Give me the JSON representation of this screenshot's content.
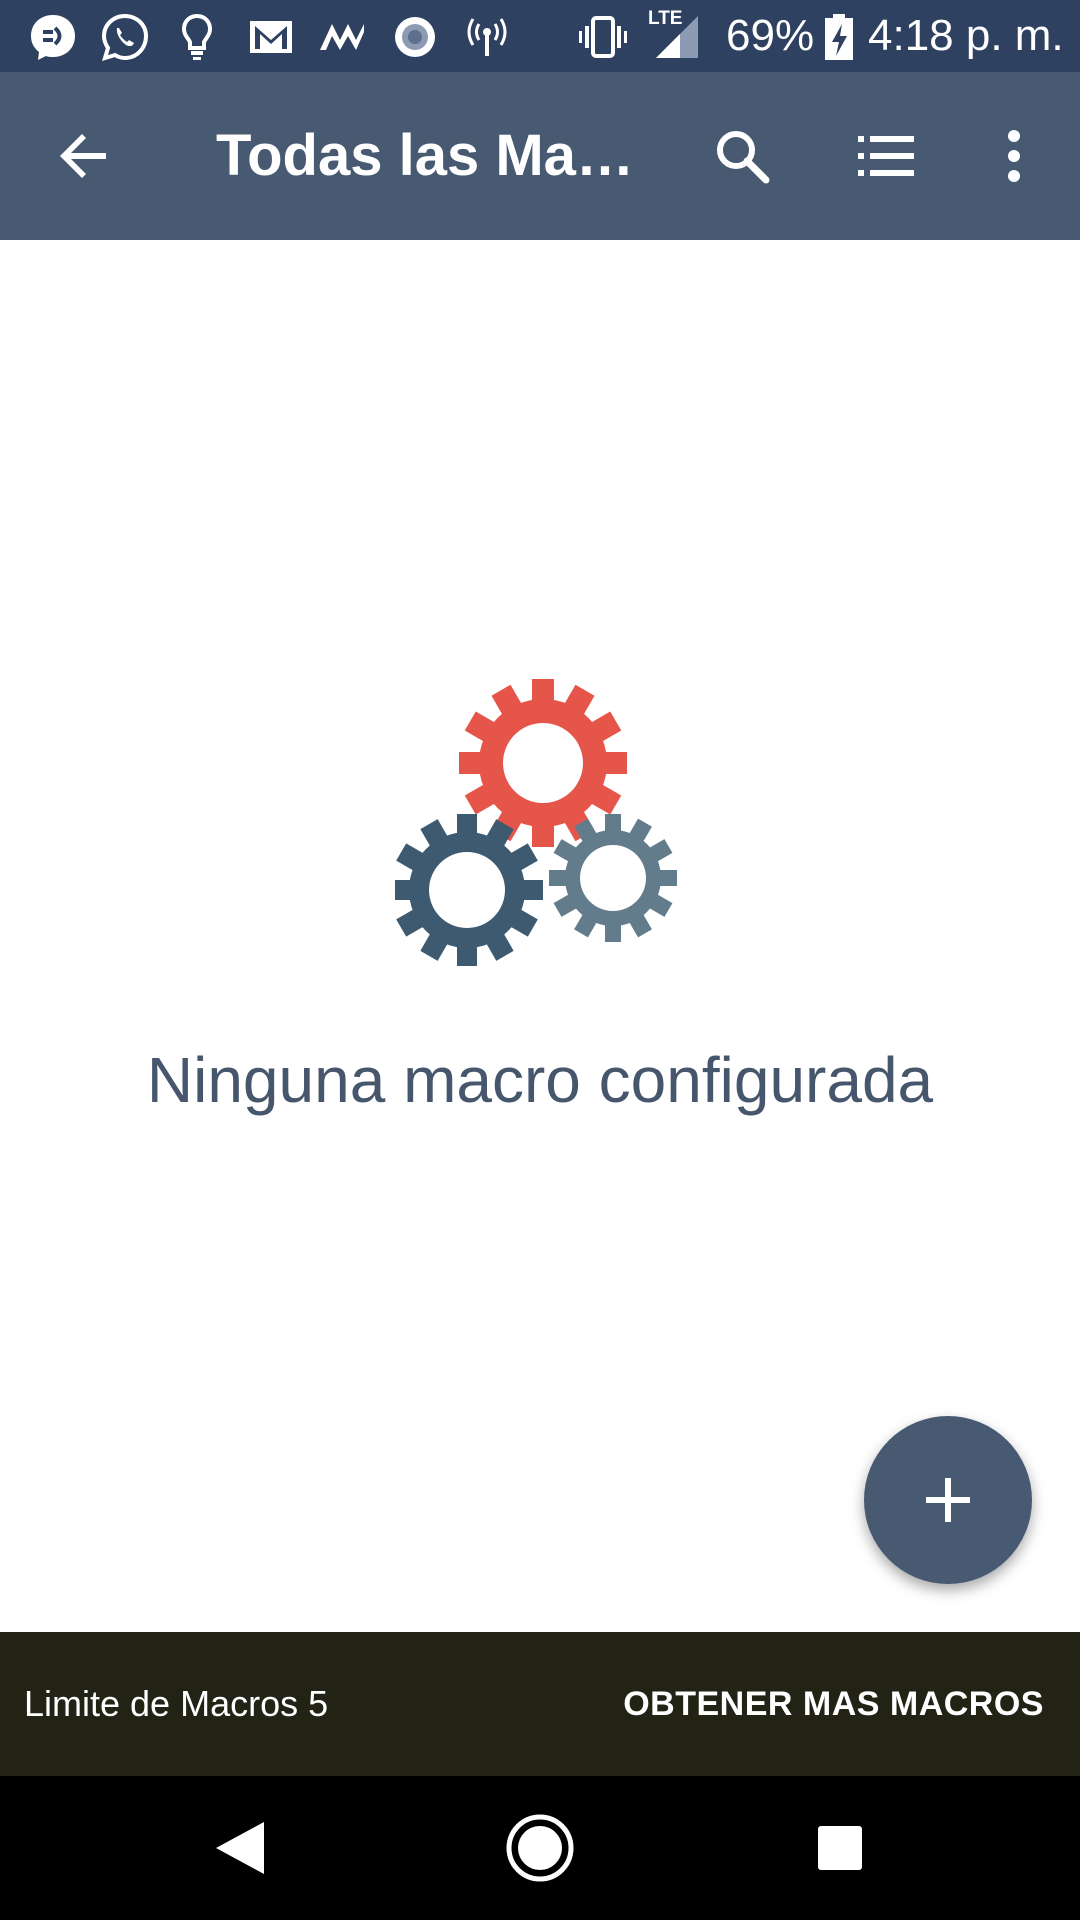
{
  "status_bar": {
    "icons": [
      "messenger-icon",
      "whatsapp-icon",
      "lightbulb-icon",
      "gmail-icon",
      "m-app-icon",
      "record-icon",
      "hotspot-icon",
      "vibrate-icon",
      "lte-signal-icon",
      "battery-charging-icon"
    ],
    "network_type": "LTE",
    "battery": "69%",
    "time": "4:18 p. m."
  },
  "app_bar": {
    "title": "Todas las Macros",
    "actions": [
      "back-arrow-icon",
      "search-icon",
      "list-icon",
      "more-vert-icon"
    ]
  },
  "empty_state": {
    "illustration": "gears-icon",
    "message": "Ninguna macro configurada"
  },
  "fab": {
    "icon": "plus-icon"
  },
  "bottom_banner": {
    "limit_text": "Limite de Macros 5",
    "button_label": "OBTENER MAS MACROS"
  },
  "nav_bar": {
    "buttons": [
      "back-triangle-icon",
      "home-circle-icon",
      "recents-square-icon"
    ]
  },
  "colors": {
    "status_bar": "#2e4161",
    "app_bar": "#475a72",
    "gear_red": "#e5554a",
    "gear_dark": "#3e5a70",
    "gear_gray": "#637c8c",
    "banner": "#222215",
    "text": "#46566c"
  }
}
